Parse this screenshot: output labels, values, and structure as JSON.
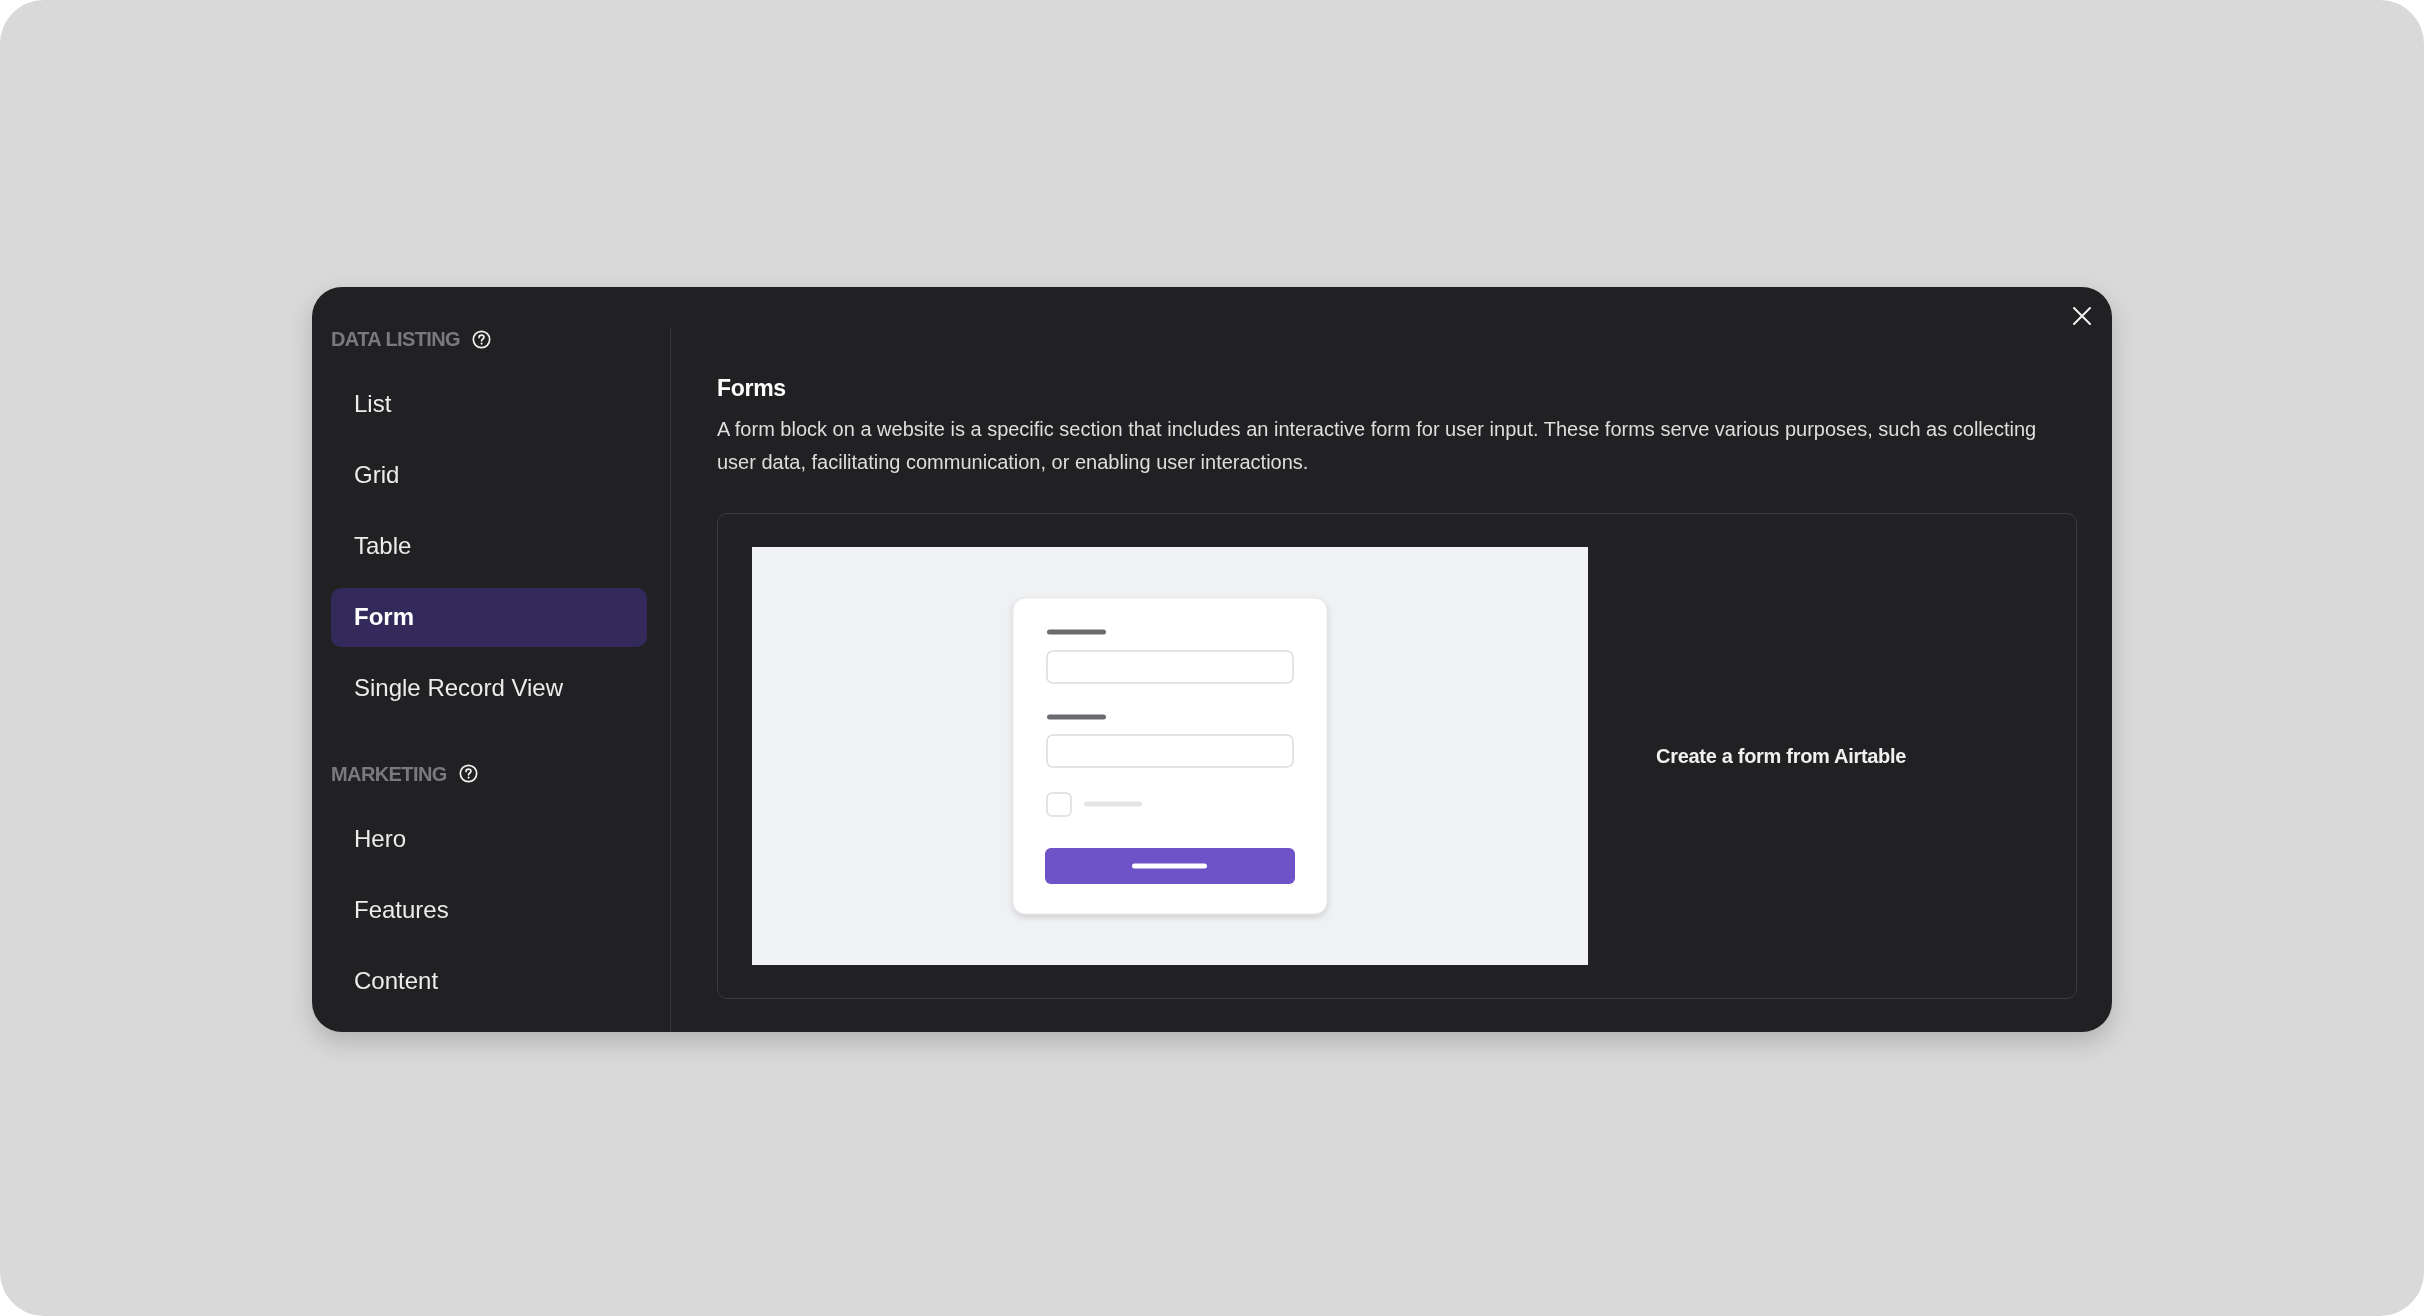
{
  "sidebar": {
    "sections": [
      {
        "heading": "DATA LISTING",
        "items": [
          {
            "label": "List",
            "selected": false
          },
          {
            "label": "Grid",
            "selected": false
          },
          {
            "label": "Table",
            "selected": false
          },
          {
            "label": "Form",
            "selected": true
          },
          {
            "label": "Single Record View",
            "selected": false
          }
        ]
      },
      {
        "heading": "MARKETING",
        "items": [
          {
            "label": "Hero",
            "selected": false
          },
          {
            "label": "Features",
            "selected": false
          },
          {
            "label": "Content",
            "selected": false
          }
        ]
      }
    ]
  },
  "content": {
    "title": "Forms",
    "description": "A form block on a website is a specific section that includes an interactive form for user input. These forms serve various purposes, such as collecting user data, facilitating communication, or enabling user interactions.",
    "preview": {
      "caption": "Create a form from Airtable"
    }
  }
}
